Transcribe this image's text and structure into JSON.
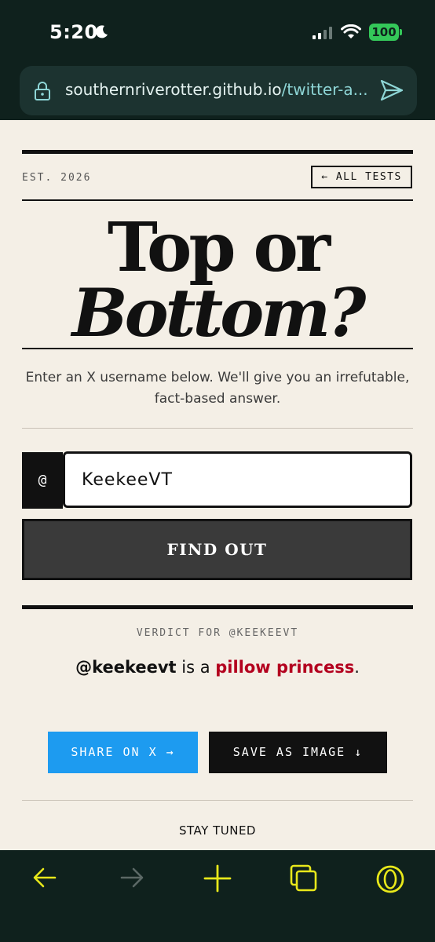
{
  "status_bar": {
    "time": "5:20",
    "battery": "100"
  },
  "browser": {
    "url_host": "southernriverotter.github.io",
    "url_path": "/twitter-a..."
  },
  "header": {
    "est": "EST. 2026",
    "all_tests": "← ALL TESTS"
  },
  "hero": {
    "title_line1": "Top or",
    "title_line2": "Bottom?",
    "subtitle": "Enter an X username below. We'll give you an irrefutable, fact-based answer."
  },
  "form": {
    "prefix": "@",
    "username_value": "KeekeeVT",
    "submit_label": "FIND OUT"
  },
  "result": {
    "label": "VERDICT FOR @KEEKEEVT",
    "handle": "@keekeevt",
    "connector": " is a ",
    "verdict": "pillow princess",
    "end": "."
  },
  "actions": {
    "share_label": "SHARE ON X →",
    "save_label": "SAVE AS IMAGE ↓"
  },
  "footer": {
    "stay_tuned": "STAY TUNED"
  },
  "colors": {
    "chrome_bg": "#0f211d",
    "page_bg": "#f4efe6",
    "accent_red": "#b3001e",
    "share_blue": "#1d9bf0",
    "toolbar_icon": "#e8e81a"
  },
  "toolbar_icons": [
    "back-arrow-icon",
    "forward-arrow-icon",
    "new-tab-plus-icon",
    "tabs-icon",
    "opera-menu-icon"
  ]
}
